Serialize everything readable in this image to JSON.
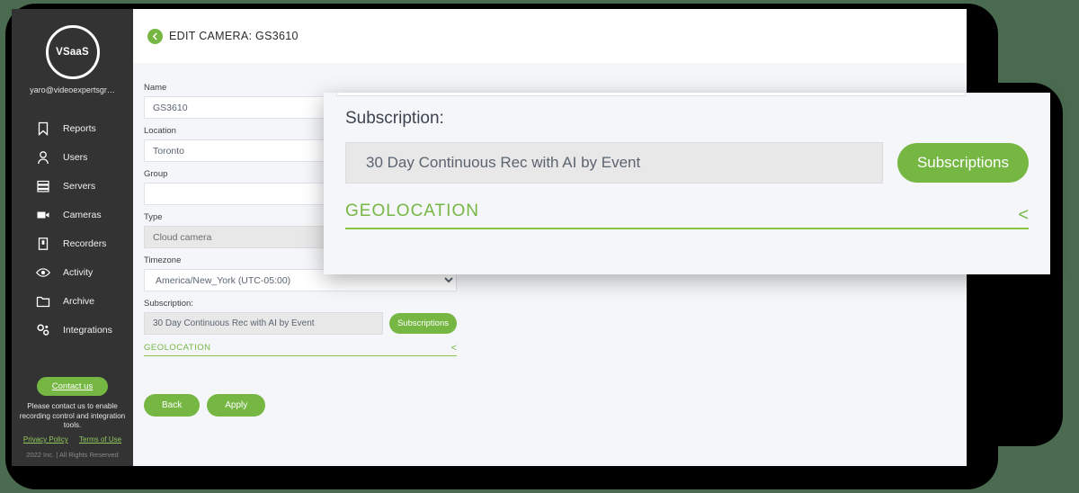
{
  "sidebar": {
    "avatar_text": "VSaaS",
    "user_email": "yaro@videoexpertsgr…",
    "items": [
      {
        "label": "Reports",
        "icon": "bookmark-icon"
      },
      {
        "label": "Users",
        "icon": "user-icon"
      },
      {
        "label": "Servers",
        "icon": "server-icon"
      },
      {
        "label": "Cameras",
        "icon": "camera-icon"
      },
      {
        "label": "Recorders",
        "icon": "recorder-icon"
      },
      {
        "label": "Activity",
        "icon": "eye-icon"
      },
      {
        "label": "Archive",
        "icon": "folder-icon"
      },
      {
        "label": "Integrations",
        "icon": "gears-icon"
      }
    ],
    "contact_button": "Contact us",
    "footer_note": "Please contact us to enable recording control and integration tools.",
    "privacy_policy": "Privacy Policy",
    "terms_of_use": "Terms of Use",
    "copyright": "2022 Inc. | All Rights Reserved"
  },
  "header": {
    "title": "EDIT CAMERA: GS3610",
    "back_icon": "back-arrow-icon"
  },
  "form": {
    "name_label": "Name",
    "name_value": "GS3610",
    "location_label": "Location",
    "location_value": "Toronto",
    "group_label": "Group",
    "group_value": "",
    "type_label": "Type",
    "type_value": "Cloud camera",
    "timezone_label": "Timezone",
    "timezone_value": "America/New_York (UTC-05:00)",
    "subscription_label": "Subscription:",
    "subscription_value": "30 Day Continuous Rec with AI by Event",
    "subscriptions_button": "Subscriptions",
    "geolocation_title": "GEOLOCATION",
    "geolocation_toggle": "<",
    "back_button": "Back",
    "apply_button": "Apply"
  },
  "overlay": {
    "subscription_label": "Subscription:",
    "subscription_value": "30 Day Continuous Rec with AI by Event",
    "subscriptions_button": "Subscriptions",
    "geolocation_title": "GEOLOCATION",
    "geolocation_toggle": "<"
  },
  "colors": {
    "accent_green": "#76b744",
    "sidebar_dark": "#333333",
    "form_background": "#f4f6f9"
  }
}
